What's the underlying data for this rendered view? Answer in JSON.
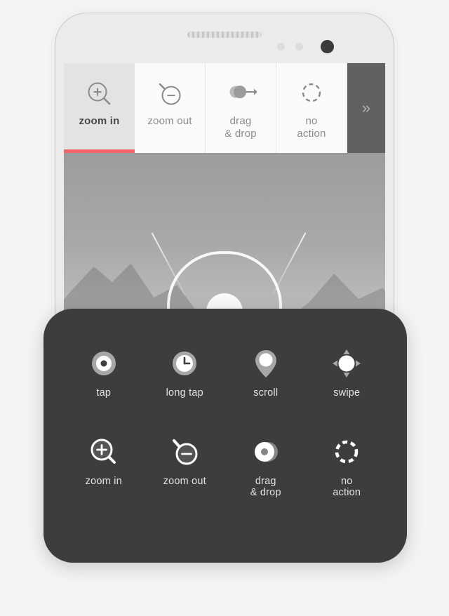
{
  "phone": {
    "hardware": {
      "speaker_grille": "speaker-grille",
      "sensor_1": "sensor-dot",
      "sensor_2": "sensor-dot",
      "camera": "camera-lens"
    },
    "toolbar": {
      "overflow_label": "»",
      "active_index": 0,
      "accent_color": "#f4626a",
      "tabs": [
        {
          "label": "zoom in",
          "icon": "zoom-in-icon",
          "active": true
        },
        {
          "label": "zoom out",
          "icon": "zoom-out-icon",
          "active": false
        },
        {
          "label": "drag\n& drop",
          "label_line1": "drag",
          "label_line2": "& drop",
          "icon": "drag-and-drop-icon",
          "active": false
        },
        {
          "label": "no action",
          "label_line1": "no",
          "label_line2": "action",
          "icon": "no-action-icon",
          "active": false
        }
      ]
    },
    "wallpaper": {
      "description": "mountain-landscape",
      "logo": "person-logo"
    }
  },
  "palette": {
    "background_color": "#3e3d3d",
    "label_color": "#e3e1e1",
    "rows": [
      {
        "items": [
          {
            "label": "tap",
            "icon": "tap-icon"
          },
          {
            "label": "long tap",
            "icon": "long-tap-icon"
          },
          {
            "label": "scroll",
            "icon": "scroll-pin-icon"
          },
          {
            "label": "swipe",
            "icon": "swipe-icon"
          }
        ]
      },
      {
        "items": [
          {
            "label": "zoom in",
            "icon": "zoom-in-icon"
          },
          {
            "label": "zoom out",
            "icon": "zoom-out-icon"
          },
          {
            "label_line1": "drag",
            "label_line2": "& drop",
            "icon": "drag-and-drop-icon"
          },
          {
            "label_line1": "no",
            "label_line2": "action",
            "icon": "no-action-icon"
          }
        ]
      }
    ]
  }
}
